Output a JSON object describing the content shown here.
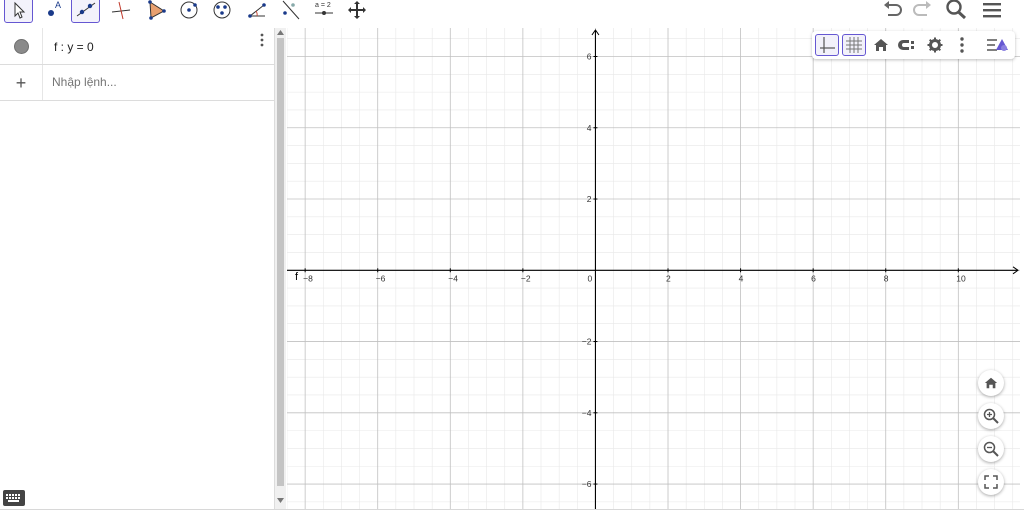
{
  "toolbar": {
    "tools": [
      {
        "name": "move-tool",
        "selected": true
      },
      {
        "name": "point-tool",
        "label": "A",
        "selected": false
      },
      {
        "name": "line-tool",
        "selected": true
      },
      {
        "name": "perpendicular-line-tool",
        "selected": false
      },
      {
        "name": "polygon-tool",
        "selected": false
      },
      {
        "name": "circle-center-point-tool",
        "selected": false
      },
      {
        "name": "circle-three-points-tool",
        "selected": false
      },
      {
        "name": "angle-tool",
        "selected": false
      },
      {
        "name": "reflect-tool",
        "selected": false
      },
      {
        "name": "slider-tool",
        "label": "a = 2",
        "selected": false
      },
      {
        "name": "move-graphics-view-tool",
        "selected": false
      }
    ],
    "actions": [
      "undo-icon",
      "redo-icon",
      "search-icon",
      "menu-icon"
    ]
  },
  "algebra": {
    "items": [
      {
        "label": "f : y = 0"
      }
    ],
    "input_placeholder": "Nhập lệnh...",
    "add_symbol": "+"
  },
  "graphics": {
    "x_ticks": [
      "−8",
      "−6",
      "−4",
      "−2",
      "0",
      "2",
      "4",
      "6",
      "8",
      "10"
    ],
    "y_ticks": [
      "6",
      "4",
      "2",
      "−2",
      "−4",
      "−6"
    ],
    "line_label": "f",
    "x_range": [
      -8.5,
      11.7
    ],
    "y_range": [
      -6.7,
      6.8
    ]
  },
  "style_bar": [
    "axes-icon",
    "grid-icon",
    "home-icon",
    "label-style-icon",
    "settings-icon",
    "more-icon",
    "toggle-style-bar-icon"
  ],
  "view_controls": [
    "home-icon",
    "zoom-in-icon",
    "zoom-out-icon",
    "fullscreen-icon"
  ],
  "colors": {
    "accent": "#6557d2",
    "axis": "#000000",
    "grid_major": "#c0c0c0",
    "grid_minor": "#e8e8e8"
  }
}
